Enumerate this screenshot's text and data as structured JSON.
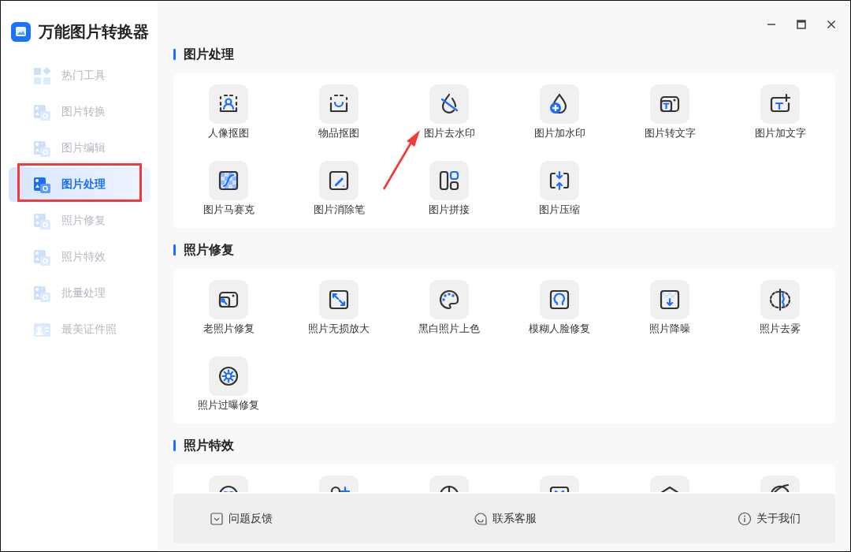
{
  "app": {
    "title": "万能图片转换器"
  },
  "sidebar": {
    "items": [
      {
        "label": "热门工具",
        "selected": false,
        "annotated": false
      },
      {
        "label": "图片转换",
        "selected": false,
        "annotated": false
      },
      {
        "label": "图片编辑",
        "selected": false,
        "annotated": false
      },
      {
        "label": "图片处理",
        "selected": true,
        "annotated": true
      },
      {
        "label": "照片修复",
        "selected": false,
        "annotated": false
      },
      {
        "label": "照片特效",
        "selected": false,
        "annotated": false
      },
      {
        "label": "批量处理",
        "selected": false,
        "annotated": false
      },
      {
        "label": "最美证件照",
        "selected": false,
        "annotated": false
      }
    ]
  },
  "sections": [
    {
      "title": "图片处理",
      "items": [
        {
          "label": "人像抠图",
          "pointed": false
        },
        {
          "label": "物品抠图",
          "pointed": false
        },
        {
          "label": "图片去水印",
          "pointed": true
        },
        {
          "label": "图片加水印",
          "pointed": false
        },
        {
          "label": "图片转文字",
          "pointed": false
        },
        {
          "label": "图片加文字",
          "pointed": false
        },
        {
          "label": "图片马赛克",
          "pointed": false
        },
        {
          "label": "图片消除笔",
          "pointed": false
        },
        {
          "label": "图片拼接",
          "pointed": false
        },
        {
          "label": "图片压缩",
          "pointed": false
        }
      ]
    },
    {
      "title": "照片修复",
      "items": [
        {
          "label": "老照片修复",
          "pointed": false
        },
        {
          "label": "照片无损放大",
          "pointed": false
        },
        {
          "label": "黑白照片上色",
          "pointed": false
        },
        {
          "label": "模糊人脸修复",
          "pointed": false
        },
        {
          "label": "照片降噪",
          "pointed": false
        },
        {
          "label": "照片去雾",
          "pointed": false
        },
        {
          "label": "照片过曝修复",
          "pointed": false
        }
      ]
    },
    {
      "title": "照片特效",
      "items": [
        {
          "kind": "tile"
        },
        {
          "kind": "tile"
        },
        {
          "kind": "tile"
        },
        {
          "kind": "tile"
        },
        {
          "kind": "tile"
        },
        {
          "kind": "tile"
        }
      ]
    }
  ],
  "footer": {
    "links": [
      "问题反馈",
      "联系客服",
      "关于我们"
    ]
  }
}
